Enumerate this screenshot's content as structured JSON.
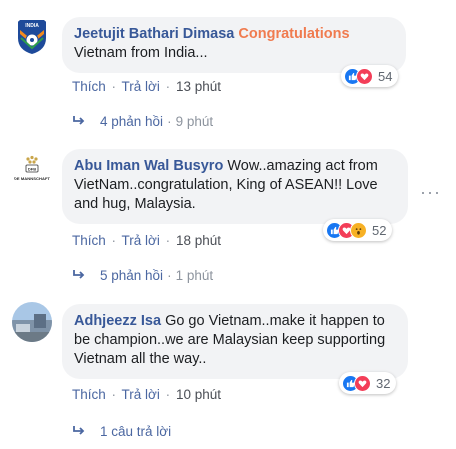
{
  "comments": [
    {
      "author": "Jeetujit Bathari Dimasa",
      "highlight": "Congratulations",
      "text": "Vietnam from India...",
      "like_label": "Thích",
      "reply_label": "Trả lời",
      "time": "13 phút",
      "reaction_icons": [
        "like-icon",
        "love-icon"
      ],
      "reaction_count": "54",
      "replies_label": "4 phản hồi",
      "replies_time": "9 phút"
    },
    {
      "author": "Abu Iman Wal Busyro",
      "text": "Wow..amazing act from VietNam..congratulation, King of ASEAN!! Love and hug, Malaysia.",
      "like_label": "Thích",
      "reply_label": "Trả lời",
      "time": "18 phút",
      "reaction_icons": [
        "like-icon",
        "love-icon",
        "wow-icon"
      ],
      "reaction_count": "52",
      "replies_label": "5 phản hồi",
      "replies_time": "1 phút",
      "avatar_caption": "DE MANNSCHAFT"
    },
    {
      "author": "Adhjeezz Isa",
      "text": "Go go Vietnam..make it happen to be champion..we are Malaysian keep supporting Vietnam all the way..",
      "like_label": "Thích",
      "reply_label": "Trả lời",
      "time": "10 phút",
      "reaction_icons": [
        "like-icon",
        "love-icon"
      ],
      "reaction_count": "32",
      "replies_label": "1 câu trả lời"
    }
  ],
  "colors": {
    "author": "#385898",
    "highlight": "#f07b4f",
    "link": "#4b67a1",
    "bubble": "#f2f3f5",
    "like": "#1877f2",
    "love": "#f33e58",
    "wow": "#f7b125"
  }
}
